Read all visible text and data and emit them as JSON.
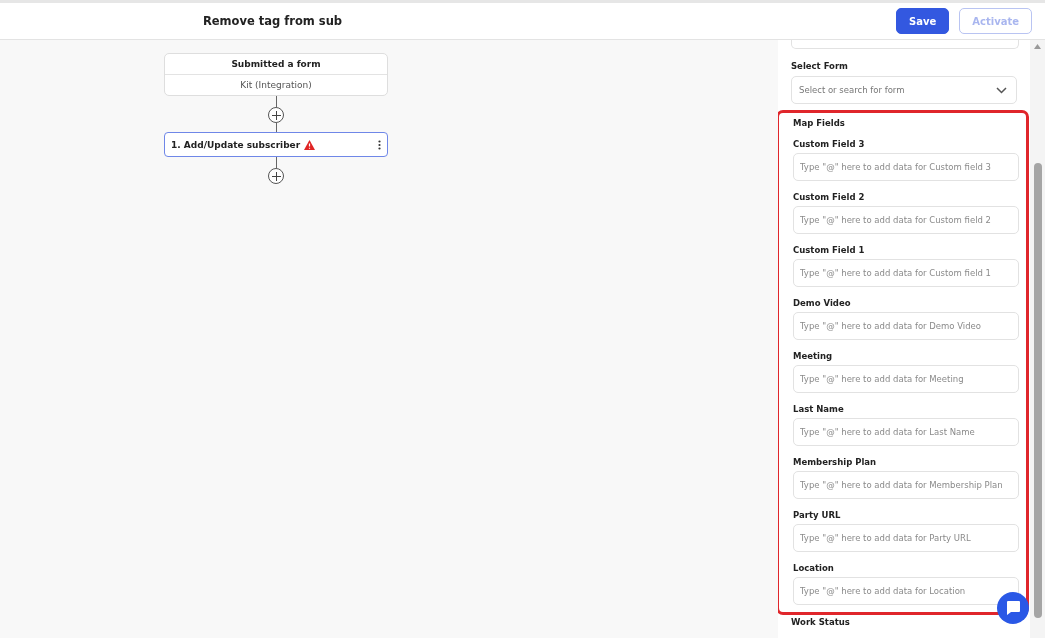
{
  "header": {
    "title": "Remove tag from sub",
    "buttons": [
      {
        "label": "Save",
        "kind": "primary",
        "disabled": false
      },
      {
        "label": "Activate",
        "kind": "outline",
        "disabled": true
      }
    ]
  },
  "canvas": {
    "trigger": {
      "title": "Submitted a form",
      "subtitle": "Kit (Integration)"
    },
    "action": {
      "title": "1. Add/Update subscriber",
      "warning": true
    }
  },
  "panel": {
    "select_form": {
      "label": "Select Form",
      "placeholder": "Select or search for form"
    },
    "map_fields": {
      "title": "Map Fields",
      "highlighted": true,
      "fields": [
        {
          "label": "Custom Field 3",
          "placeholder": "Type \"@\" here to add data for Custom field 3"
        },
        {
          "label": "Custom Field 2",
          "placeholder": "Type \"@\" here to add data for Custom field 2"
        },
        {
          "label": "Custom Field 1",
          "placeholder": "Type \"@\" here to add data for Custom field 1"
        },
        {
          "label": "Demo Video",
          "placeholder": "Type \"@\" here to add data for Demo Video"
        },
        {
          "label": "Meeting",
          "placeholder": "Type \"@\" here to add data for Meeting"
        },
        {
          "label": "Last Name",
          "placeholder": "Type \"@\" here to add data for Last Name"
        },
        {
          "label": "Membership Plan",
          "placeholder": "Type \"@\" here to add data for Membership Plan"
        },
        {
          "label": "Party URL",
          "placeholder": "Type \"@\" here to add data for Party URL"
        },
        {
          "label": "Location",
          "placeholder": "Type \"@\" here to add data for Location"
        }
      ]
    },
    "next_label": "Work Status"
  }
}
